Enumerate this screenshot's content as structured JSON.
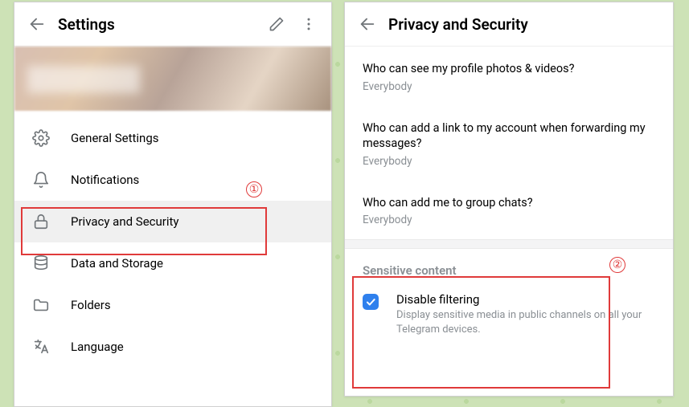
{
  "left": {
    "title": "Settings",
    "menu": [
      {
        "icon": "gear",
        "label": "General Settings"
      },
      {
        "icon": "bell",
        "label": "Notifications"
      },
      {
        "icon": "lock",
        "label": "Privacy and Security"
      },
      {
        "icon": "database",
        "label": "Data and Storage"
      },
      {
        "icon": "folder",
        "label": "Folders"
      },
      {
        "icon": "language",
        "label": "Language"
      }
    ]
  },
  "right": {
    "title": "Privacy and Security",
    "privacy": [
      {
        "q": "Who can see my profile photos & videos?",
        "v": "Everybody"
      },
      {
        "q": "Who can add a link to my account when forwarding my messages?",
        "v": "Everybody"
      },
      {
        "q": "Who can add me to group chats?",
        "v": "Everybody"
      }
    ],
    "sensitive": {
      "section": "Sensitive content",
      "label": "Disable filtering",
      "desc": "Display sensitive media in public channels on all your Telegram devices.",
      "checked": true
    }
  },
  "callouts": {
    "one": "①",
    "two": "②"
  }
}
